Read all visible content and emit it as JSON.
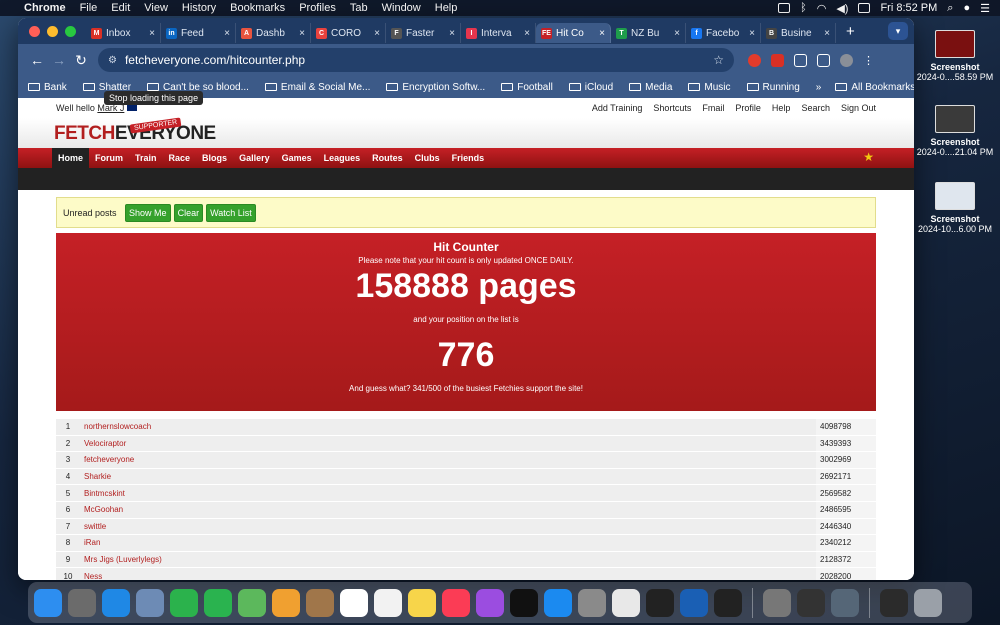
{
  "menubar": {
    "app": "Chrome",
    "menus": [
      "File",
      "Edit",
      "View",
      "History",
      "Bookmarks",
      "Profiles",
      "Tab",
      "Window",
      "Help"
    ],
    "clock": "Fri 8:52 PM"
  },
  "tabs": [
    {
      "label": "Inbox",
      "color": "#d93025",
      "icon": "M"
    },
    {
      "label": "Feed",
      "color": "#0a66c2",
      "icon": "in"
    },
    {
      "label": "Dashb",
      "color": "#e8543f",
      "icon": "A"
    },
    {
      "label": "CORO",
      "color": "#e8423d",
      "icon": "C"
    },
    {
      "label": "Faster",
      "color": "#555555",
      "icon": "F"
    },
    {
      "label": "Interva",
      "color": "#e6354d",
      "icon": "I"
    },
    {
      "label": "Hit Co",
      "color": "#c52026",
      "icon": "FE"
    },
    {
      "label": "NZ Bu",
      "color": "#1e9c4b",
      "icon": "T"
    },
    {
      "label": "Facebo",
      "color": "#1877f2",
      "icon": "f"
    },
    {
      "label": "Busine",
      "color": "#444444",
      "icon": "B"
    }
  ],
  "address": {
    "url": "fetcheveryone.com/hitcounter.php"
  },
  "tooltip": "Stop loading this page",
  "bookmarks": {
    "items": [
      "Bank",
      "Shatter",
      "Can't be so blood...",
      "Email & Social Me...",
      "Encryption Softw...",
      "Football",
      "iCloud",
      "Media",
      "Music",
      "Running"
    ],
    "overflow": "»",
    "all": "All Bookmarks"
  },
  "site": {
    "greeting": "Well hello",
    "user": "Mark J",
    "toplinks": [
      "Add Training",
      "Shortcuts",
      "Fmail",
      "Profile",
      "Help",
      "Search",
      "Sign Out"
    ],
    "logo_a": "FETCH",
    "logo_b": "EVERYONE",
    "badge": "SUPPORTER",
    "nav": [
      "Home",
      "Forum",
      "Train",
      "Race",
      "Blogs",
      "Gallery",
      "Games",
      "Leagues",
      "Routes",
      "Clubs",
      "Friends"
    ]
  },
  "unread": {
    "label": "Unread posts",
    "buttons": [
      "Show Me",
      "Clear",
      "Watch List"
    ]
  },
  "hitcounter": {
    "title": "Hit Counter",
    "note": "Please note that your hit count is only updated ONCE DAILY.",
    "pages": "158888 pages",
    "position_label": "and your position on the list is",
    "position": "776",
    "footer": "And guess what? 341/500 of the busiest Fetchies support the site!"
  },
  "rankings": [
    {
      "rank": "1",
      "name": "northernslowcoach",
      "hits": "4098798"
    },
    {
      "rank": "2",
      "name": "Velociraptor",
      "hits": "3439393"
    },
    {
      "rank": "3",
      "name": "fetcheveryone",
      "hits": "3002969"
    },
    {
      "rank": "4",
      "name": "Sharkie",
      "hits": "2692171"
    },
    {
      "rank": "5",
      "name": "Bintmcskint",
      "hits": "2569582"
    },
    {
      "rank": "6",
      "name": "McGoohan",
      "hits": "2486595"
    },
    {
      "rank": "7",
      "name": "swittle",
      "hits": "2446340"
    },
    {
      "rank": "8",
      "name": "iRan",
      "hits": "2340212"
    },
    {
      "rank": "9",
      "name": "Mrs Jigs (Luverlylegs)",
      "hits": "2128372"
    },
    {
      "rank": "10",
      "name": "Ness",
      "hits": "2028200"
    }
  ],
  "desktop": [
    {
      "name": "Screenshot",
      "date": "2024-0....58.59 PM"
    },
    {
      "name": "Screenshot",
      "date": "2024-0....21.04 PM"
    },
    {
      "name": "Screenshot",
      "date": "2024-10...6.00 PM"
    }
  ],
  "dock": [
    {
      "icon": "finder",
      "color": "#2d8ef0"
    },
    {
      "icon": "launchpad",
      "color": "#6b6b6b"
    },
    {
      "icon": "safari",
      "color": "#1f88e5"
    },
    {
      "icon": "preview",
      "color": "#6d8bb5"
    },
    {
      "icon": "facetime",
      "color": "#2bb24c"
    },
    {
      "icon": "messages",
      "color": "#2ab34f"
    },
    {
      "icon": "maps",
      "color": "#5cb85c"
    },
    {
      "icon": "photos",
      "color": "#f0a030"
    },
    {
      "icon": "contacts",
      "color": "#a0764a"
    },
    {
      "icon": "calendar",
      "color": "#ffffff"
    },
    {
      "icon": "reminders",
      "color": "#f2f2f2"
    },
    {
      "icon": "notes",
      "color": "#f7d54a"
    },
    {
      "icon": "music",
      "color": "#fb3c55"
    },
    {
      "icon": "podcasts",
      "color": "#9b4de0"
    },
    {
      "icon": "tv",
      "color": "#111111"
    },
    {
      "icon": "app-store",
      "color": "#1b8af0"
    },
    {
      "icon": "settings",
      "color": "#8a8a8a"
    },
    {
      "icon": "chrome",
      "color": "#e8e8e8"
    },
    {
      "icon": "unity",
      "color": "#222222"
    },
    {
      "icon": "audio",
      "color": "#1a5fb4"
    },
    {
      "icon": "headphones",
      "color": "#222222"
    },
    {
      "icon": "utility",
      "color": "#777777"
    },
    {
      "icon": "tool",
      "color": "#333333"
    },
    {
      "icon": "migration",
      "color": "#556677"
    },
    {
      "icon": "downloads",
      "color": "#2b2b2b"
    },
    {
      "icon": "trash",
      "color": "#9aa0a8"
    }
  ]
}
